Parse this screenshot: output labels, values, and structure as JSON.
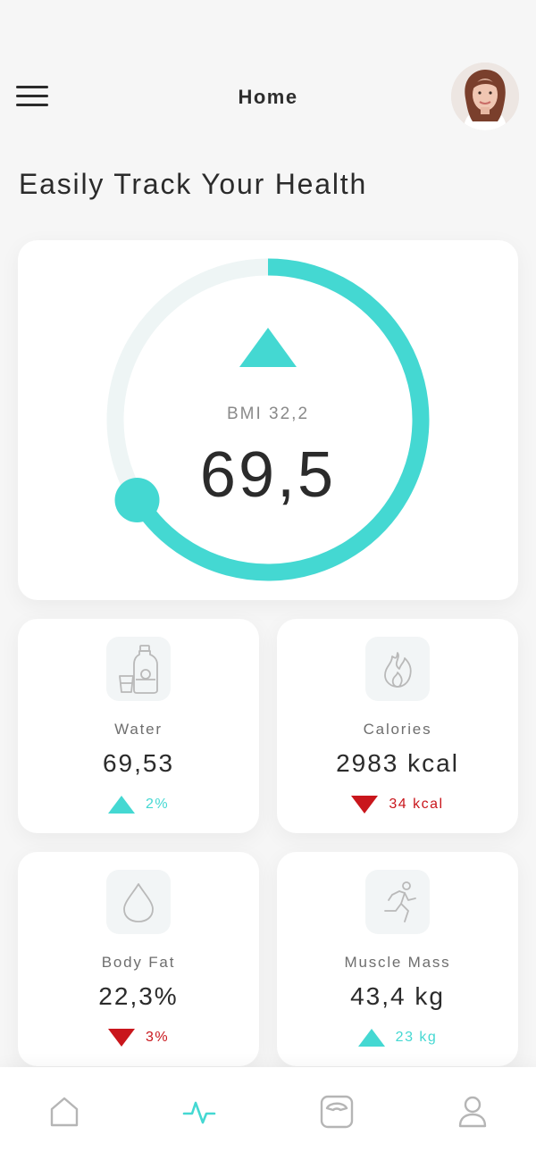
{
  "header": {
    "title": "Home"
  },
  "headline": "Easily Track Your Health",
  "main": {
    "bmi_label": "BMI 32,2",
    "weight": "69,5",
    "trend": "up",
    "accent_color": "#44d8d2"
  },
  "stats": [
    {
      "label": "Water",
      "value": "69,53",
      "change": "2%",
      "trend": "up",
      "icon": "water-bottle-icon"
    },
    {
      "label": "Calories",
      "value": "2983 kcal",
      "change": "34 kcal",
      "trend": "down",
      "icon": "flame-icon"
    },
    {
      "label": "Body Fat",
      "value": "22,3%",
      "change": "3%",
      "trend": "down",
      "icon": "droplet-icon"
    },
    {
      "label": "Muscle Mass",
      "value": "43,4 kg",
      "change": "23 kg",
      "trend": "up",
      "icon": "running-person-icon"
    }
  ],
  "nav": {
    "items": [
      "home-icon",
      "activity-pulse-icon",
      "scale-icon",
      "profile-icon"
    ],
    "active": "activity-pulse-icon"
  },
  "colors": {
    "accent": "#44d8d2",
    "down": "#c9161c",
    "text": "#2b2b2b",
    "background": "#f6f6f6"
  }
}
